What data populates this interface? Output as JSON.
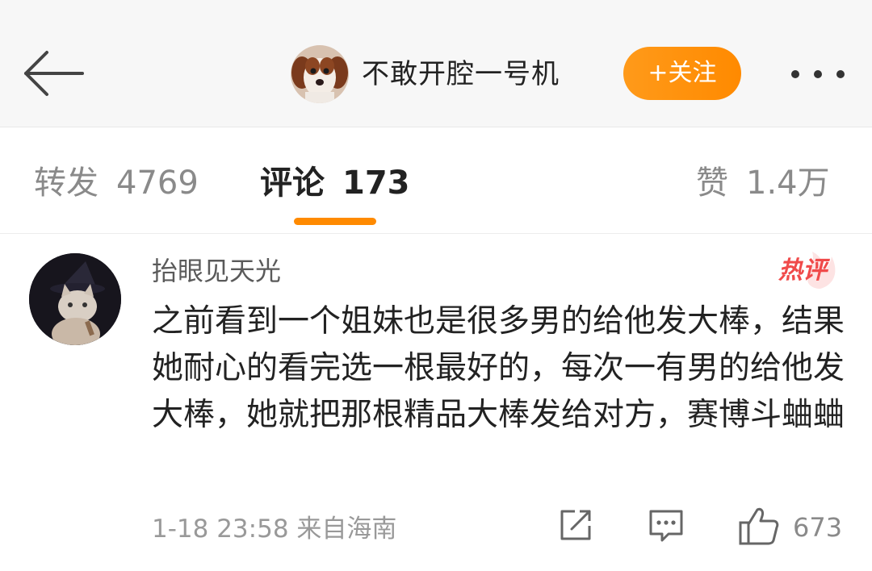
{
  "header": {
    "back_icon": "back-arrow-icon",
    "title": "不敢开腔一号机",
    "follow_label": "+关注",
    "more_icon": "more-dots-icon",
    "accent_color": "#ff8a00"
  },
  "tabs": [
    {
      "label": "转发",
      "count": "4769"
    },
    {
      "label": "评论",
      "count": "173"
    },
    {
      "label": "赞",
      "count": "1.4万"
    }
  ],
  "comment": {
    "username": "抬眼见天光",
    "badge": "热评",
    "text": "之前看到一个姐妹也是很多男的给他发大棒，结果她耐心的看完选一根最好的，每次一有男的给他发大棒，她就把那根精品大棒发给对方，赛博斗蛐蛐",
    "meta": "1-18  23:58  来自海南",
    "like_count": "673",
    "icons": [
      "share-icon",
      "comment-icon",
      "like-icon"
    ]
  }
}
